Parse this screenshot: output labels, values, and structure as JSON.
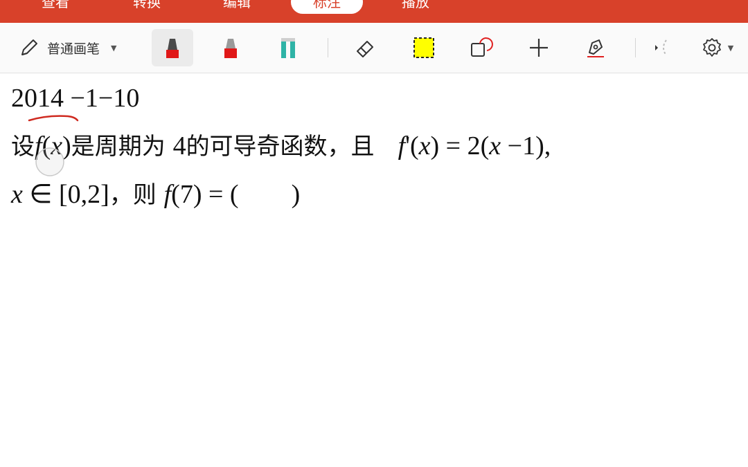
{
  "menubar": {
    "tabs": [
      {
        "label": "查看",
        "active": false
      },
      {
        "label": "转换",
        "active": false
      },
      {
        "label": "编辑",
        "active": false
      },
      {
        "label": "标注",
        "active": true
      },
      {
        "label": "播放",
        "active": false
      }
    ]
  },
  "toolbar": {
    "pen_mode_label": "普通画笔",
    "tools": [
      "marker-dark",
      "marker-red",
      "highlighter-teal",
      "eraser",
      "select-rect",
      "shape",
      "plus",
      "pen-signature",
      "collapse",
      "settings"
    ]
  },
  "document": {
    "line1": {
      "year": "2014",
      "rest": " −1−10"
    },
    "line2": {
      "t1": "设",
      "f1": "f",
      "p1": "(",
      "x1": "x",
      "p2": ")",
      "t2": "是周期为 ",
      "n4": "4",
      "t3": "的可导奇函数，且",
      "f2": "f",
      "prime": "'",
      "p3": "(",
      "x2": "x",
      "p4": ")",
      "eq": " = 2(",
      "x3": "x",
      "tail": " −1),"
    },
    "line3": {
      "x": "x",
      "in": " ∈ [0,2]",
      "t1": "，则 ",
      "f": "f",
      "arg": "(7) = (",
      "gap": "        ",
      "close": ")"
    }
  },
  "colors": {
    "brand_red": "#d8412a",
    "ink_red": "#cf2a20",
    "marker_red": "#e02020",
    "highlighter_teal": "#2fb3a6",
    "select_yellow": "#ffff00"
  }
}
